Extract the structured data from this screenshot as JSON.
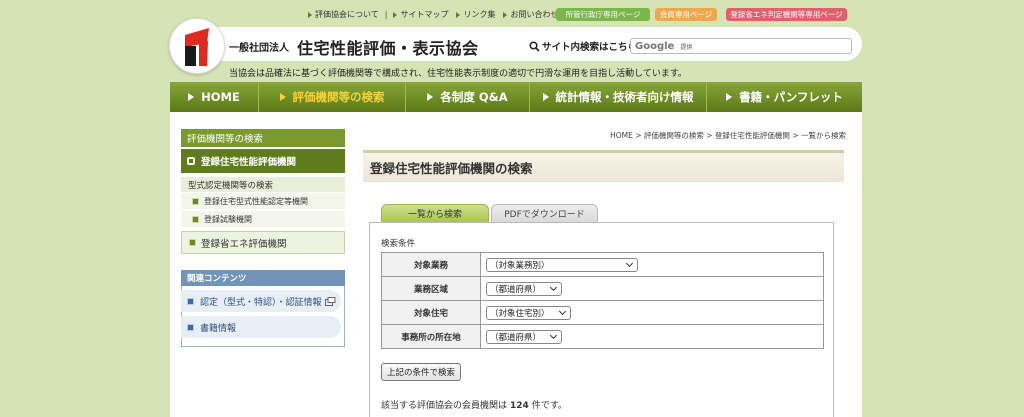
{
  "utility": {
    "links": [
      "評価協会について",
      "サイトマップ",
      "リンク集",
      "お問い合わせ"
    ],
    "separator": "|",
    "pills": [
      {
        "label": "所管行政庁専用ページ",
        "color": "#7ab648"
      },
      {
        "label": "会員専用ページ",
        "color": "#eda84a"
      },
      {
        "label": "登録省エネ判定機関等専用ページ",
        "color": "#e0606e"
      }
    ]
  },
  "header": {
    "org_prefix": "一般社団法人",
    "org_name": "住宅性能評価・表示協会",
    "search_label": "サイト内検索はこちら",
    "google_label": "Google",
    "search_placeholder": "提供",
    "tagline": "当協会は品確法に基づく評価機関等で構成され、住宅性能表示制度の適切で円滑な運用を目指し活動しています。"
  },
  "nav": {
    "items": [
      {
        "label": "HOME",
        "active": false
      },
      {
        "label": "評価機関等の検索",
        "active": true
      },
      {
        "label": "各制度 Q&A",
        "active": false
      },
      {
        "label": "統計情報・技術者向け情報",
        "active": false
      },
      {
        "label": "書籍・パンフレット",
        "active": false
      }
    ]
  },
  "sidebar": {
    "heading": "評価機関等の検索",
    "active_item": "登録住宅性能評価機関",
    "sub_title": "型式認定機関等の検索",
    "sub_items": [
      "登録住宅型式性能認定等機関",
      "登録試験機関"
    ],
    "item2": "登録省エネ評価機関",
    "related_heading": "関連コンテンツ",
    "related_items": [
      "認定（型式・特認）・認証情報",
      "書籍情報"
    ]
  },
  "main": {
    "breadcrumb": "HOME > 評価機関等の検索 > 登録住宅性能評価機関 > 一覧から検索",
    "title": "登録住宅性能評価機関の検索",
    "tabs": [
      "一覧から検索",
      "PDFでダウンロード"
    ],
    "conditions_label": "検索条件",
    "rows": [
      {
        "label": "対象業務",
        "value": "（対象業務別）"
      },
      {
        "label": "業務区域",
        "value": "（都道府県）"
      },
      {
        "label": "対象住宅",
        "value": "（対象住宅別）"
      },
      {
        "label": "事務所の所在地",
        "value": "（都道府県）"
      }
    ],
    "search_button": "上記の条件で検索",
    "result_prefix": "該当する評価協会の会員機関は",
    "result_count": "124",
    "result_suffix": "件です。"
  }
}
